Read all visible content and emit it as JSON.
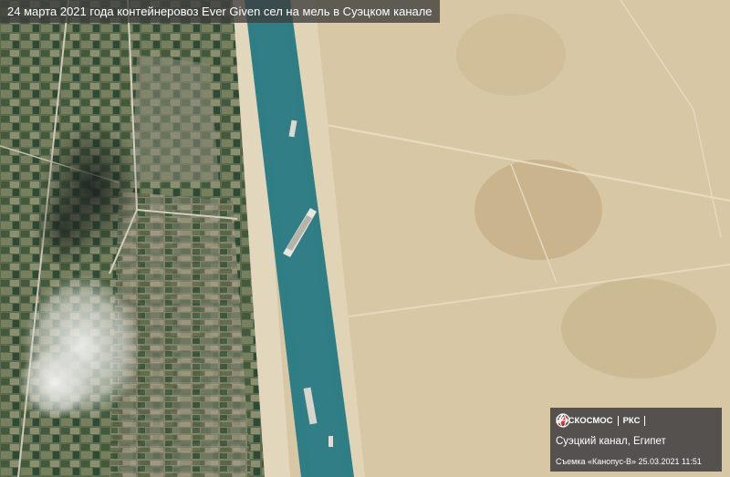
{
  "caption": "24 марта 2021 года контейнеровоз Ever Given сел на мель в Суэцком канале",
  "credit": {
    "logo_roscosmos": "РОСКОСМОС",
    "logo_rks": "РКС",
    "location": "Суэцкий канал, Египет",
    "shot_info": "Съемка «Канопус-В» 25.03.2021 11:51"
  },
  "icons": [
    "roscosmos-logo-icon",
    "rks-logo-icon",
    "globe-seal-icon"
  ],
  "colors": {
    "canal": "#2f7e86",
    "desert": "#d8c7a4",
    "farmland": "#5f6a4e",
    "caption_bg": "#3c3c3c"
  }
}
